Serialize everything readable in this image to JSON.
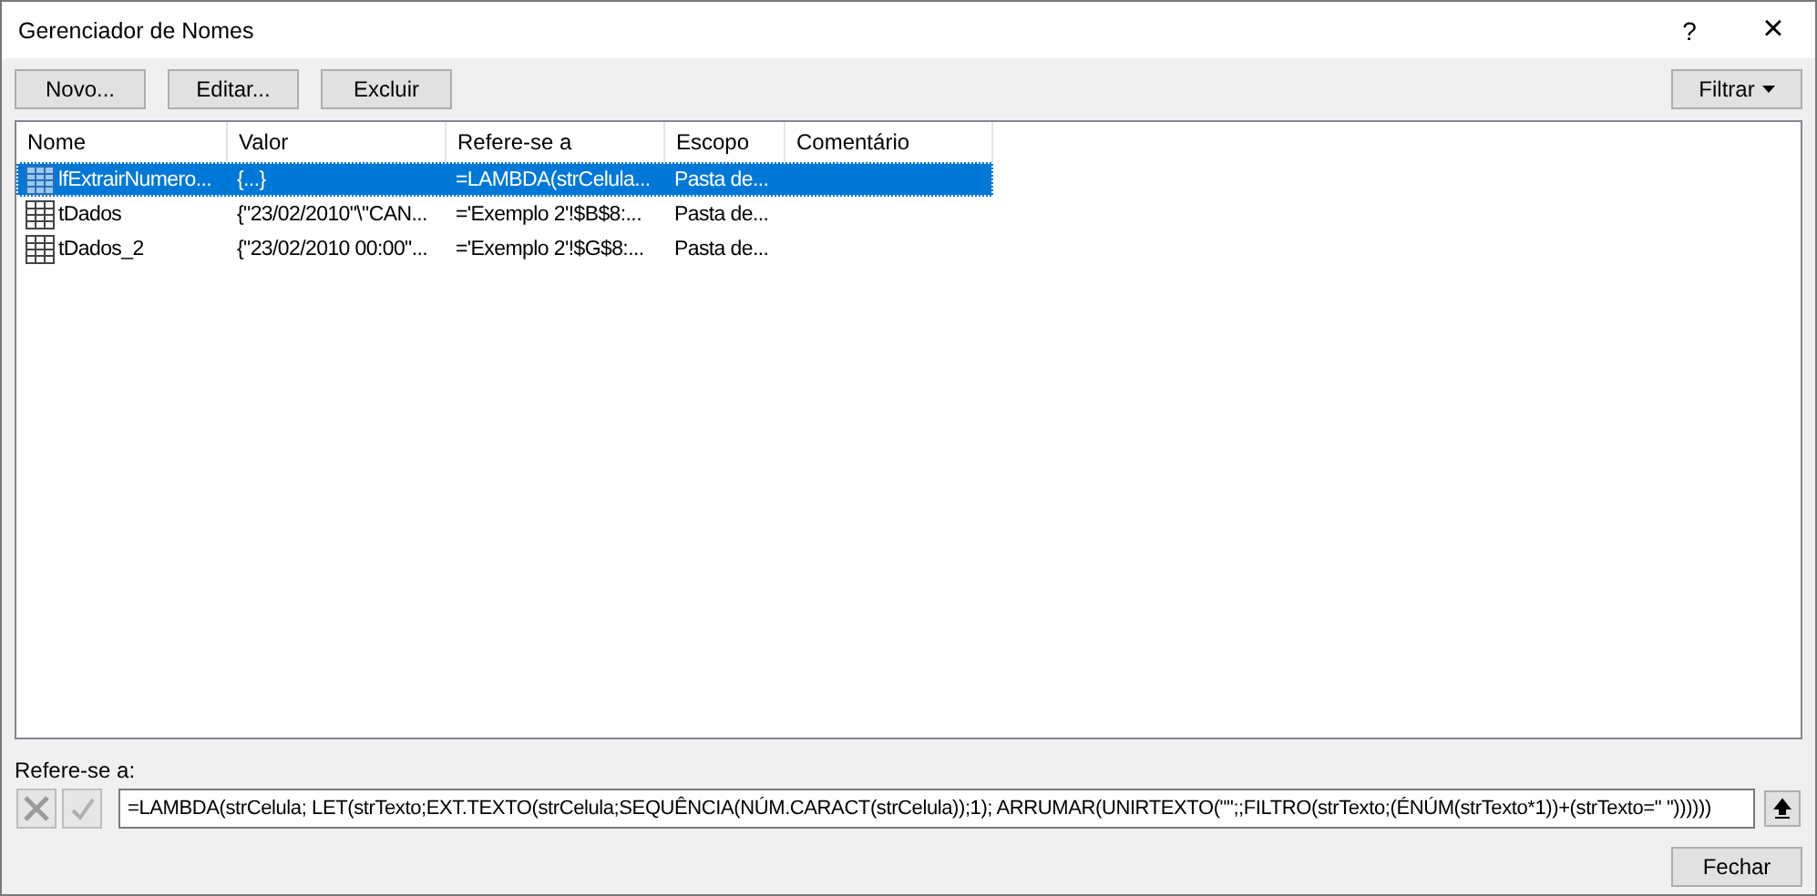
{
  "window": {
    "title": "Gerenciador de Nomes",
    "help": "?",
    "close": "×"
  },
  "toolbar": {
    "buttons": [
      "Novo...",
      "Editar...",
      "Excluir"
    ],
    "filter": "Filtrar"
  },
  "table": {
    "columns": [
      "Nome",
      "Valor",
      "Refere-se a",
      "Escopo",
      "Comentário"
    ],
    "rows": [
      {
        "kind": "function",
        "name": "lfExtrairNumero...",
        "value": "{...}",
        "refers": "=LAMBDA(strCelula...",
        "scope": "Pasta de...",
        "comment": "",
        "selected": true
      },
      {
        "kind": "table",
        "name": "tDados",
        "value": "{\"23/02/2010\"\\\"CAN...",
        "refers": "='Exemplo 2'!$B$8:...",
        "scope": "Pasta de...",
        "comment": "",
        "selected": false
      },
      {
        "kind": "table",
        "name": "tDados_2",
        "value": "{\"23/02/2010 00:00\"...",
        "refers": "='Exemplo 2'!$G$8:...",
        "scope": "Pasta de...",
        "comment": "",
        "selected": false
      }
    ]
  },
  "refers_to": {
    "label": "Refere-se a:",
    "value": "=LAMBDA(strCelula; LET(strTexto;EXT.TEXTO(strCelula;SEQUÊNCIA(NÚM.CARACT(strCelula));1); ARRUMAR(UNIRTEXTO(\"\";;FILTRO(strTexto;(ÉNÚM(strTexto*1))+(strTexto=\" \"))))))"
  },
  "footer": {
    "close_button": "Fechar"
  }
}
